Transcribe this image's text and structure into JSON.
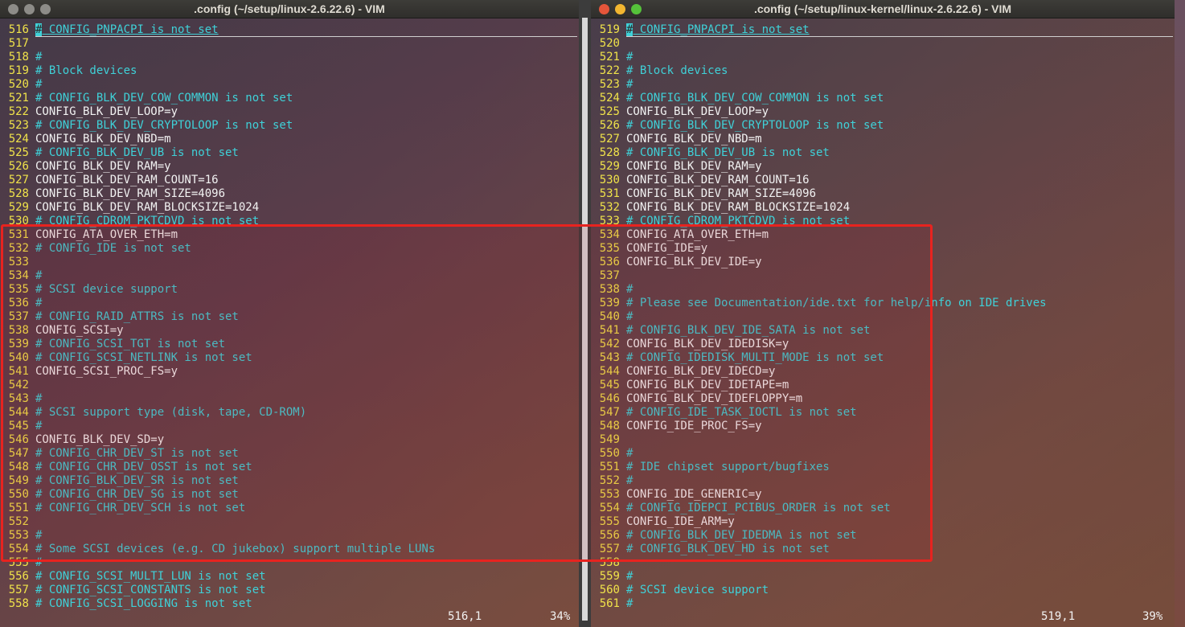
{
  "left": {
    "title": ".config (~/setup/linux-2.6.22.6) - VIM",
    "cursor_char": "#",
    "lines": [
      {
        "n": "516",
        "t": " CONFIG_PNPACPI is not set",
        "c": true,
        "cur": true
      },
      {
        "n": "517",
        "t": "",
        "c": false
      },
      {
        "n": "518",
        "t": "#",
        "c": true
      },
      {
        "n": "519",
        "t": "# Block devices",
        "c": true
      },
      {
        "n": "520",
        "t": "#",
        "c": true
      },
      {
        "n": "521",
        "t": "# CONFIG_BLK_DEV_COW_COMMON is not set",
        "c": true
      },
      {
        "n": "522",
        "t": "CONFIG_BLK_DEV_LOOP=y",
        "c": false
      },
      {
        "n": "523",
        "t": "# CONFIG_BLK_DEV_CRYPTOLOOP is not set",
        "c": true
      },
      {
        "n": "524",
        "t": "CONFIG_BLK_DEV_NBD=m",
        "c": false
      },
      {
        "n": "525",
        "t": "# CONFIG_BLK_DEV_UB is not set",
        "c": true
      },
      {
        "n": "526",
        "t": "CONFIG_BLK_DEV_RAM=y",
        "c": false
      },
      {
        "n": "527",
        "t": "CONFIG_BLK_DEV_RAM_COUNT=16",
        "c": false
      },
      {
        "n": "528",
        "t": "CONFIG_BLK_DEV_RAM_SIZE=4096",
        "c": false
      },
      {
        "n": "529",
        "t": "CONFIG_BLK_DEV_RAM_BLOCKSIZE=1024",
        "c": false
      },
      {
        "n": "530",
        "t": "# CONFIG_CDROM_PKTCDVD is not set",
        "c": true
      },
      {
        "n": "531",
        "t": "CONFIG_ATA_OVER_ETH=m",
        "c": false
      },
      {
        "n": "532",
        "t": "# CONFIG_IDE is not set",
        "c": true
      },
      {
        "n": "533",
        "t": "",
        "c": false
      },
      {
        "n": "534",
        "t": "#",
        "c": true
      },
      {
        "n": "535",
        "t": "# SCSI device support",
        "c": true
      },
      {
        "n": "536",
        "t": "#",
        "c": true
      },
      {
        "n": "537",
        "t": "# CONFIG_RAID_ATTRS is not set",
        "c": true
      },
      {
        "n": "538",
        "t": "CONFIG_SCSI=y",
        "c": false
      },
      {
        "n": "539",
        "t": "# CONFIG_SCSI_TGT is not set",
        "c": true
      },
      {
        "n": "540",
        "t": "# CONFIG_SCSI_NETLINK is not set",
        "c": true
      },
      {
        "n": "541",
        "t": "CONFIG_SCSI_PROC_FS=y",
        "c": false
      },
      {
        "n": "542",
        "t": "",
        "c": false
      },
      {
        "n": "543",
        "t": "#",
        "c": true
      },
      {
        "n": "544",
        "t": "# SCSI support type (disk, tape, CD-ROM)",
        "c": true
      },
      {
        "n": "545",
        "t": "#",
        "c": true
      },
      {
        "n": "546",
        "t": "CONFIG_BLK_DEV_SD=y",
        "c": false
      },
      {
        "n": "547",
        "t": "# CONFIG_CHR_DEV_ST is not set",
        "c": true
      },
      {
        "n": "548",
        "t": "# CONFIG_CHR_DEV_OSST is not set",
        "c": true
      },
      {
        "n": "549",
        "t": "# CONFIG_BLK_DEV_SR is not set",
        "c": true
      },
      {
        "n": "550",
        "t": "# CONFIG_CHR_DEV_SG is not set",
        "c": true
      },
      {
        "n": "551",
        "t": "# CONFIG_CHR_DEV_SCH is not set",
        "c": true
      },
      {
        "n": "552",
        "t": "",
        "c": false
      },
      {
        "n": "553",
        "t": "#",
        "c": true
      },
      {
        "n": "554",
        "t": "# Some SCSI devices (e.g. CD jukebox) support multiple LUNs",
        "c": true
      },
      {
        "n": "555",
        "t": "#",
        "c": true
      },
      {
        "n": "556",
        "t": "# CONFIG_SCSI_MULTI_LUN is not set",
        "c": true
      },
      {
        "n": "557",
        "t": "# CONFIG_SCSI_CONSTANTS is not set",
        "c": true
      },
      {
        "n": "558",
        "t": "# CONFIG_SCSI_LOGGING is not set",
        "c": true
      }
    ],
    "status_pos": "516,1",
    "status_pct": "34%"
  },
  "right": {
    "title": ".config (~/setup/linux-kernel/linux-2.6.22.6) - VIM",
    "cursor_char": "#",
    "lines": [
      {
        "n": "519",
        "t": " CONFIG_PNPACPI is not set",
        "c": true,
        "cur": true
      },
      {
        "n": "520",
        "t": "",
        "c": false
      },
      {
        "n": "521",
        "t": "#",
        "c": true
      },
      {
        "n": "522",
        "t": "# Block devices",
        "c": true
      },
      {
        "n": "523",
        "t": "#",
        "c": true
      },
      {
        "n": "524",
        "t": "# CONFIG_BLK_DEV_COW_COMMON is not set",
        "c": true
      },
      {
        "n": "525",
        "t": "CONFIG_BLK_DEV_LOOP=y",
        "c": false
      },
      {
        "n": "526",
        "t": "# CONFIG_BLK_DEV_CRYPTOLOOP is not set",
        "c": true
      },
      {
        "n": "527",
        "t": "CONFIG_BLK_DEV_NBD=m",
        "c": false
      },
      {
        "n": "528",
        "t": "# CONFIG_BLK_DEV_UB is not set",
        "c": true
      },
      {
        "n": "529",
        "t": "CONFIG_BLK_DEV_RAM=y",
        "c": false
      },
      {
        "n": "530",
        "t": "CONFIG_BLK_DEV_RAM_COUNT=16",
        "c": false
      },
      {
        "n": "531",
        "t": "CONFIG_BLK_DEV_RAM_SIZE=4096",
        "c": false
      },
      {
        "n": "532",
        "t": "CONFIG_BLK_DEV_RAM_BLOCKSIZE=1024",
        "c": false
      },
      {
        "n": "533",
        "t": "# CONFIG_CDROM_PKTCDVD is not set",
        "c": true
      },
      {
        "n": "534",
        "t": "CONFIG_ATA_OVER_ETH=m",
        "c": false
      },
      {
        "n": "535",
        "t": "CONFIG_IDE=y",
        "c": false
      },
      {
        "n": "536",
        "t": "CONFIG_BLK_DEV_IDE=y",
        "c": false
      },
      {
        "n": "537",
        "t": "",
        "c": false
      },
      {
        "n": "538",
        "t": "#",
        "c": true
      },
      {
        "n": "539",
        "t": "# Please see Documentation/ide.txt for help/info on IDE drives",
        "c": true
      },
      {
        "n": "540",
        "t": "#",
        "c": true
      },
      {
        "n": "541",
        "t": "# CONFIG_BLK_DEV_IDE_SATA is not set",
        "c": true
      },
      {
        "n": "542",
        "t": "CONFIG_BLK_DEV_IDEDISK=y",
        "c": false
      },
      {
        "n": "543",
        "t": "# CONFIG_IDEDISK_MULTI_MODE is not set",
        "c": true
      },
      {
        "n": "544",
        "t": "CONFIG_BLK_DEV_IDECD=y",
        "c": false
      },
      {
        "n": "545",
        "t": "CONFIG_BLK_DEV_IDETAPE=m",
        "c": false
      },
      {
        "n": "546",
        "t": "CONFIG_BLK_DEV_IDEFLOPPY=m",
        "c": false
      },
      {
        "n": "547",
        "t": "# CONFIG_IDE_TASK_IOCTL is not set",
        "c": true
      },
      {
        "n": "548",
        "t": "CONFIG_IDE_PROC_FS=y",
        "c": false
      },
      {
        "n": "549",
        "t": "",
        "c": false
      },
      {
        "n": "550",
        "t": "#",
        "c": true
      },
      {
        "n": "551",
        "t": "# IDE chipset support/bugfixes",
        "c": true
      },
      {
        "n": "552",
        "t": "#",
        "c": true
      },
      {
        "n": "553",
        "t": "CONFIG_IDE_GENERIC=y",
        "c": false
      },
      {
        "n": "554",
        "t": "# CONFIG_IDEPCI_PCIBUS_ORDER is not set",
        "c": true
      },
      {
        "n": "555",
        "t": "CONFIG_IDE_ARM=y",
        "c": false
      },
      {
        "n": "556",
        "t": "# CONFIG_BLK_DEV_IDEDMA is not set",
        "c": true
      },
      {
        "n": "557",
        "t": "# CONFIG_BLK_DEV_HD is not set",
        "c": true
      },
      {
        "n": "558",
        "t": "",
        "c": false
      },
      {
        "n": "559",
        "t": "#",
        "c": true
      },
      {
        "n": "560",
        "t": "# SCSI device support",
        "c": true
      },
      {
        "n": "561",
        "t": "#",
        "c": true
      }
    ],
    "status_pos": "519,1",
    "status_pct": "39%"
  },
  "colors": {
    "line_number": "#f0e34a",
    "comment": "#3fd1d8",
    "text": "#f2f2f2",
    "highlight_box": "#e8231f"
  }
}
